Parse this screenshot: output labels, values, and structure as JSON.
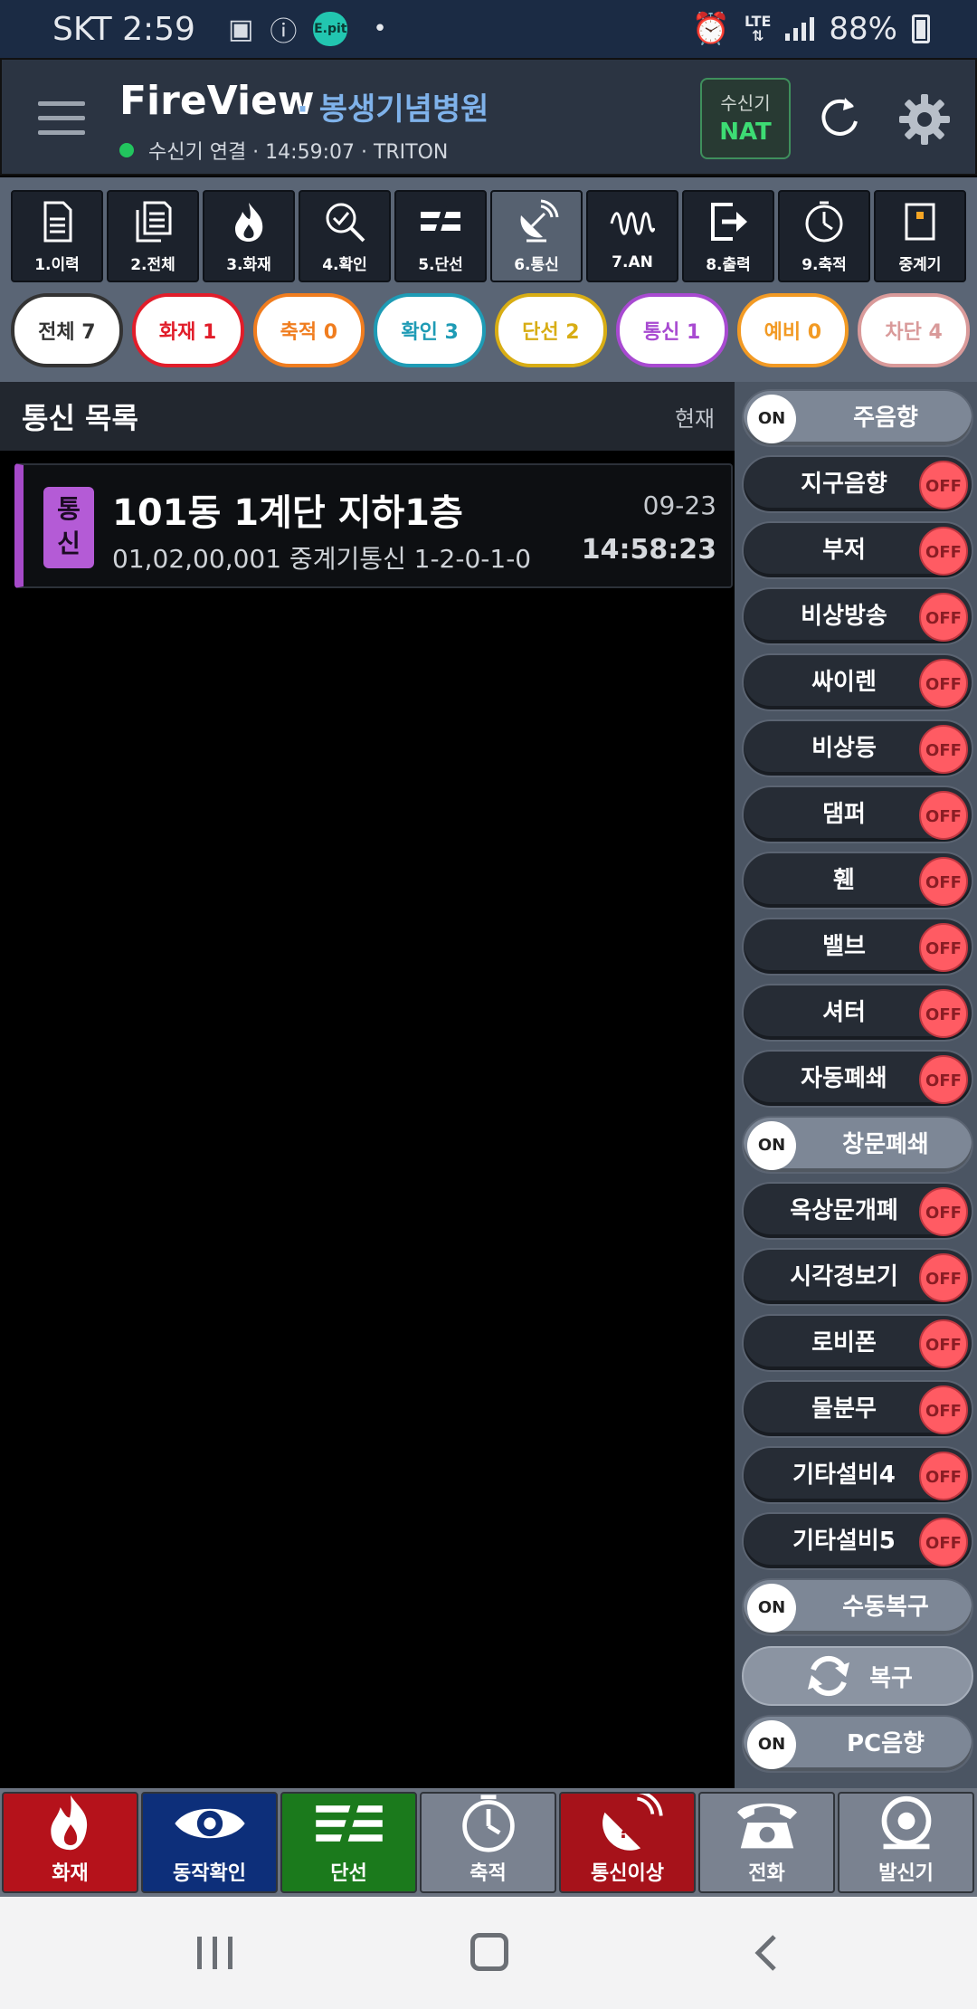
{
  "status_bar": {
    "carrier_time": "SKT 2:59",
    "epit_label": "E.pit",
    "lte": "LTE",
    "battery": "88%"
  },
  "header": {
    "title": "FireView",
    "site": "· 봉생기념병원",
    "connection": "수신기 연결 · 14:59:07 · TRITON",
    "receiver_label": "수신기",
    "receiver_value": "NAT"
  },
  "tabs": [
    {
      "label": "1.이력",
      "icon": "document-icon"
    },
    {
      "label": "2.전체",
      "icon": "documents-icon"
    },
    {
      "label": "3.화재",
      "icon": "fire-icon"
    },
    {
      "label": "4.확인",
      "icon": "magnifier-check-icon"
    },
    {
      "label": "5.단선",
      "icon": "broken-line-icon"
    },
    {
      "label": "6.통신",
      "icon": "satellite-icon",
      "active": true
    },
    {
      "label": "7.AN",
      "icon": "wave-icon"
    },
    {
      "label": "8.출력",
      "icon": "exit-icon"
    },
    {
      "label": "9.축적",
      "icon": "timer-icon"
    },
    {
      "label": "중계기",
      "icon": "repeater-icon"
    }
  ],
  "filters": [
    {
      "label": "전체 7",
      "color": "#333333"
    },
    {
      "label": "화재 1",
      "color": "#e11d2a"
    },
    {
      "label": "축적 0",
      "color": "#f07d1f"
    },
    {
      "label": "확인 3",
      "color": "#1e9bb5"
    },
    {
      "label": "단선 2",
      "color": "#d8ad14"
    },
    {
      "label": "통신 1",
      "color": "#a84ad1"
    },
    {
      "label": "예비 0",
      "color": "#f29a24"
    },
    {
      "label": "차단 4",
      "color": "#d99a9a"
    }
  ],
  "list": {
    "title": "통신 목록",
    "now_label": "현재",
    "events": [
      {
        "badge": "통신",
        "title": "101동 1계단 지하1층",
        "subtitle": "01,02,00,001 중계기통신 1-2-0-1-0",
        "date": "09-23",
        "time": "14:58:23"
      }
    ]
  },
  "controls": [
    {
      "label": "주음향",
      "state": "ON"
    },
    {
      "label": "지구음향",
      "state": "OFF"
    },
    {
      "label": "부저",
      "state": "OFF"
    },
    {
      "label": "비상방송",
      "state": "OFF"
    },
    {
      "label": "싸이렌",
      "state": "OFF"
    },
    {
      "label": "비상등",
      "state": "OFF"
    },
    {
      "label": "댐퍼",
      "state": "OFF"
    },
    {
      "label": "휀",
      "state": "OFF"
    },
    {
      "label": "밸브",
      "state": "OFF"
    },
    {
      "label": "셔터",
      "state": "OFF"
    },
    {
      "label": "자동폐쇄",
      "state": "OFF"
    },
    {
      "label": "창문폐쇄",
      "state": "ON"
    },
    {
      "label": "옥상문개폐",
      "state": "OFF"
    },
    {
      "label": "시각경보기",
      "state": "OFF"
    },
    {
      "label": "로비폰",
      "state": "OFF"
    },
    {
      "label": "물분무",
      "state": "OFF"
    },
    {
      "label": "기타설비4",
      "state": "OFF"
    },
    {
      "label": "기타설비5",
      "state": "OFF"
    },
    {
      "label": "수동복구",
      "state": "ON"
    }
  ],
  "restore_button": "복구",
  "pc_sound": {
    "label": "PC음향",
    "state": "ON"
  },
  "actions": [
    {
      "label": "화재",
      "icon": "fire-icon",
      "bg": "#b5121b"
    },
    {
      "label": "동작확인",
      "icon": "eye-icon",
      "bg": "#0d2f7a"
    },
    {
      "label": "단선",
      "icon": "broken-line-icon",
      "bg": "#1b7a1c"
    },
    {
      "label": "축적",
      "icon": "timer-icon",
      "bg": "#7a8290"
    },
    {
      "label": "통신이상",
      "icon": "satellite-alert-icon",
      "bg": "#a6121a"
    },
    {
      "label": "전화",
      "icon": "telephone-icon",
      "bg": "#7a8290"
    },
    {
      "label": "발신기",
      "icon": "alarm-bell-icon",
      "bg": "#7a8290"
    }
  ]
}
